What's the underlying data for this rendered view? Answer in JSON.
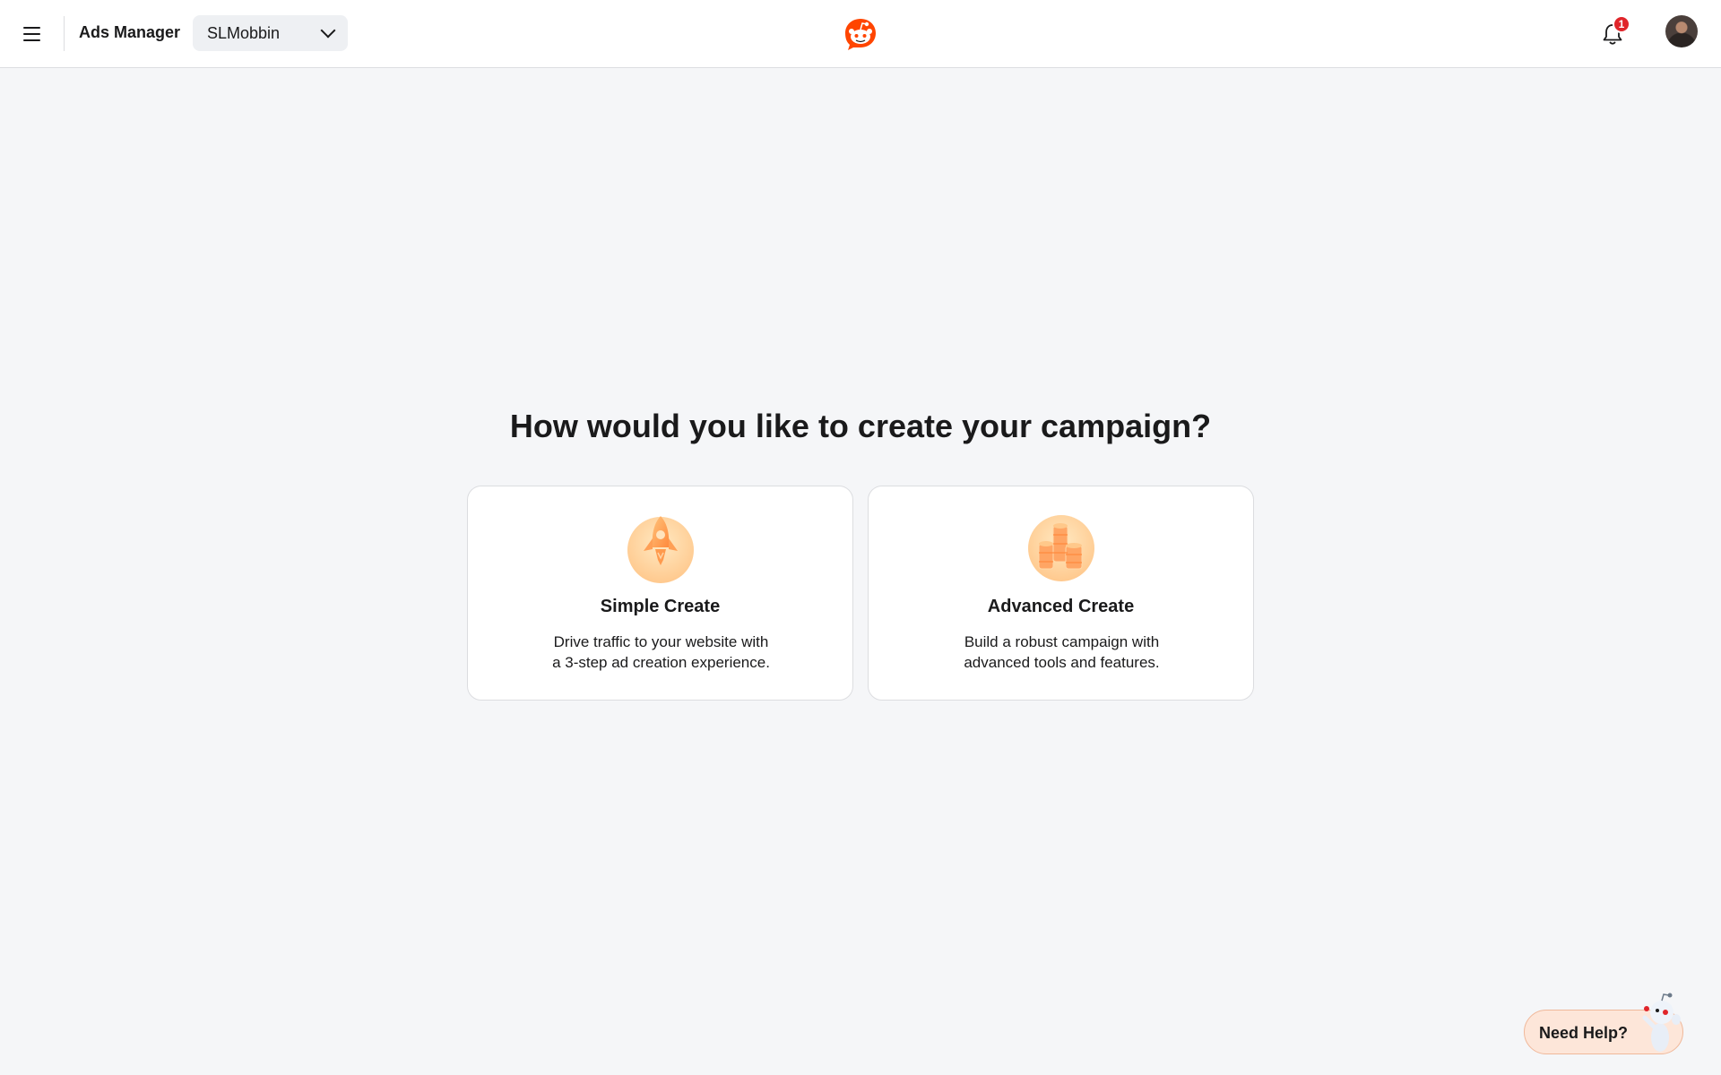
{
  "header": {
    "app_title": "Ads Manager",
    "account": "SLMobbin",
    "notification_count": "1"
  },
  "main": {
    "heading": "How would you like to create your campaign?",
    "options": [
      {
        "title": "Simple Create",
        "description_line1": "Drive traffic to your website with",
        "description_line2": "a 3-step ad creation experience.",
        "icon": "rocket-icon"
      },
      {
        "title": "Advanced Create",
        "description_line1": "Build a robust campaign with",
        "description_line2": "advanced tools and features.",
        "icon": "coins-icon"
      }
    ]
  },
  "help": {
    "label": "Need Help?"
  },
  "colors": {
    "brand": "#ff4500",
    "badge": "#e0252a",
    "icon_accent": "#ffa564"
  }
}
